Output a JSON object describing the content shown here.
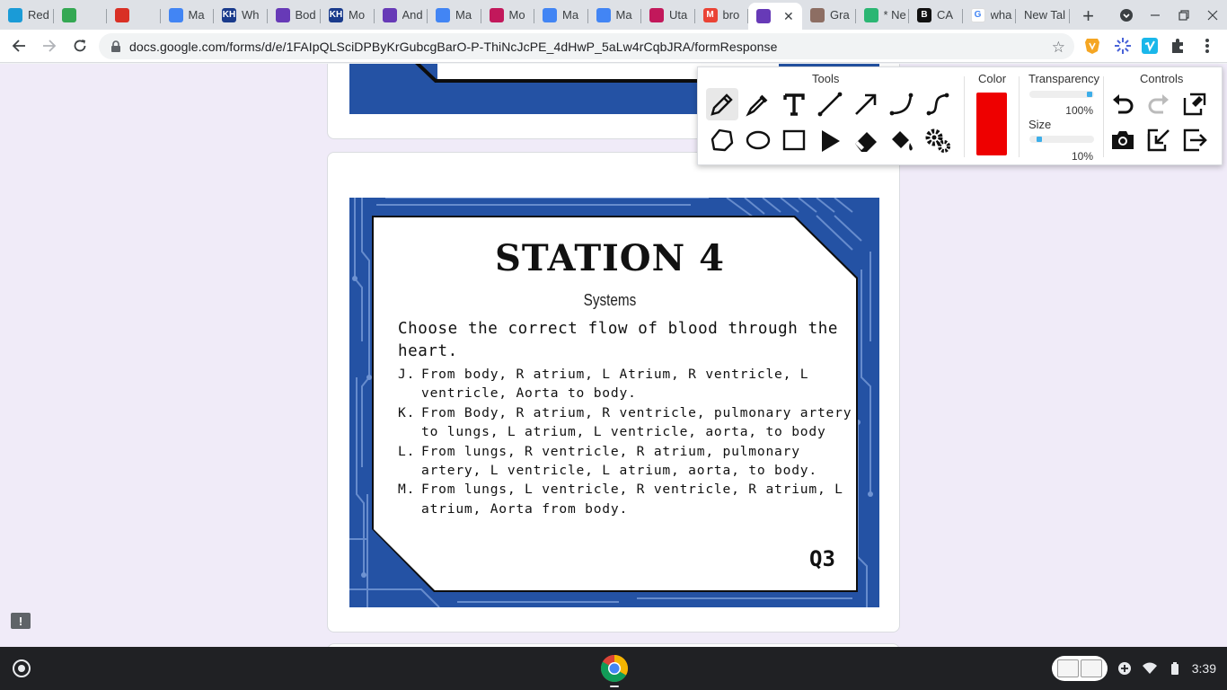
{
  "browser": {
    "tabs": [
      {
        "label": "Red",
        "favicon_color": "#1a9bd7",
        "favicon_char": ""
      },
      {
        "label": "",
        "favicon_color": "#34a853",
        "favicon_char": ""
      },
      {
        "label": "",
        "favicon_color": "#d93025",
        "favicon_char": ""
      },
      {
        "label": "Ma",
        "favicon_color": "#4285f4",
        "favicon_char": ""
      },
      {
        "label": "Wh",
        "favicon_color": "#1a3b8c",
        "favicon_char": "KH"
      },
      {
        "label": "Bod",
        "favicon_color": "#673ab7",
        "favicon_char": ""
      },
      {
        "label": "Mo",
        "favicon_color": "#1a3b8c",
        "favicon_char": "KH"
      },
      {
        "label": "And",
        "favicon_color": "#673ab7",
        "favicon_char": ""
      },
      {
        "label": "Ma",
        "favicon_color": "#4285f4",
        "favicon_char": ""
      },
      {
        "label": "Mo",
        "favicon_color": "#c2185b",
        "favicon_char": ""
      },
      {
        "label": "Ma",
        "favicon_color": "#4285f4",
        "favicon_char": ""
      },
      {
        "label": "Ma",
        "favicon_color": "#4285f4",
        "favicon_char": ""
      },
      {
        "label": "Uta",
        "favicon_color": "#c2185b",
        "favicon_char": ""
      },
      {
        "label": "bro",
        "favicon_color": "#ea4335",
        "favicon_char": "M"
      },
      {
        "label": "",
        "favicon_color": "#673ab7",
        "favicon_char": ""
      },
      {
        "label": "Gra",
        "favicon_color": "#8d6e63",
        "favicon_char": ""
      },
      {
        "label": "* Ne",
        "favicon_color": "#2bb673",
        "favicon_char": ""
      },
      {
        "label": "CA",
        "favicon_color": "#111111",
        "favicon_char": "B"
      },
      {
        "label": "wha",
        "favicon_color": "#ffffff",
        "favicon_char": "G"
      },
      {
        "label": "New Tal",
        "favicon_color": "",
        "favicon_char": ""
      }
    ],
    "active_tab_close": "✕",
    "new_tab_symbol": "+",
    "url": "docs.google.com/forms/d/e/1FAIpQLSciDPByKrGubcgBarO-P-ThiNcJcPE_4dHwP_5aLw4rCqbJRA/formResponse"
  },
  "station": {
    "title": "STATION 4",
    "subtitle": "Systems",
    "question": "Choose the correct flow of blood through the heart.",
    "options": [
      {
        "letter": "J.",
        "text": "From body, R atrium, L Atrium, R ventricle, L ventricle, Aorta to body."
      },
      {
        "letter": "K.",
        "text": "From Body, R atrium, R ventricle, pulmonary artery to lungs, L atrium, L ventricle, aorta, to body"
      },
      {
        "letter": "L.",
        "text": "From lungs, R ventricle, R atrium, pulmonary artery, L ventricle, L atrium, aorta, to body."
      },
      {
        "letter": "M.",
        "text": "From lungs, L ventricle, R ventricle, R atrium, L atrium, Aorta from body."
      }
    ],
    "question_code": "Q3"
  },
  "annotation_panel": {
    "tools_heading": "Tools",
    "color_heading": "Color",
    "transparency_heading": "Transparency",
    "size_heading": "Size",
    "controls_heading": "Controls",
    "selected_color": "#ee0000",
    "transparency_value": "100%",
    "transparency_level": 1.0,
    "size_value": "10%",
    "size_level": 0.1,
    "tools_row1": [
      "pen-icon",
      "highlighter-icon",
      "text-icon",
      "line-icon",
      "arrow-icon",
      "curve-icon",
      "freeform-curve-icon"
    ],
    "tools_row2": [
      "polygon-icon",
      "ellipse-icon",
      "rectangle-icon",
      "pointer-icon",
      "eraser-icon",
      "fill-bucket-icon",
      "settings-icon"
    ],
    "controls_row1": [
      "undo-icon",
      "redo-icon",
      "clear-icon"
    ],
    "controls_row2": [
      "camera-icon",
      "export-icon",
      "exit-icon"
    ]
  },
  "feedback_icon": "!",
  "shelf": {
    "clock": "3:39"
  }
}
